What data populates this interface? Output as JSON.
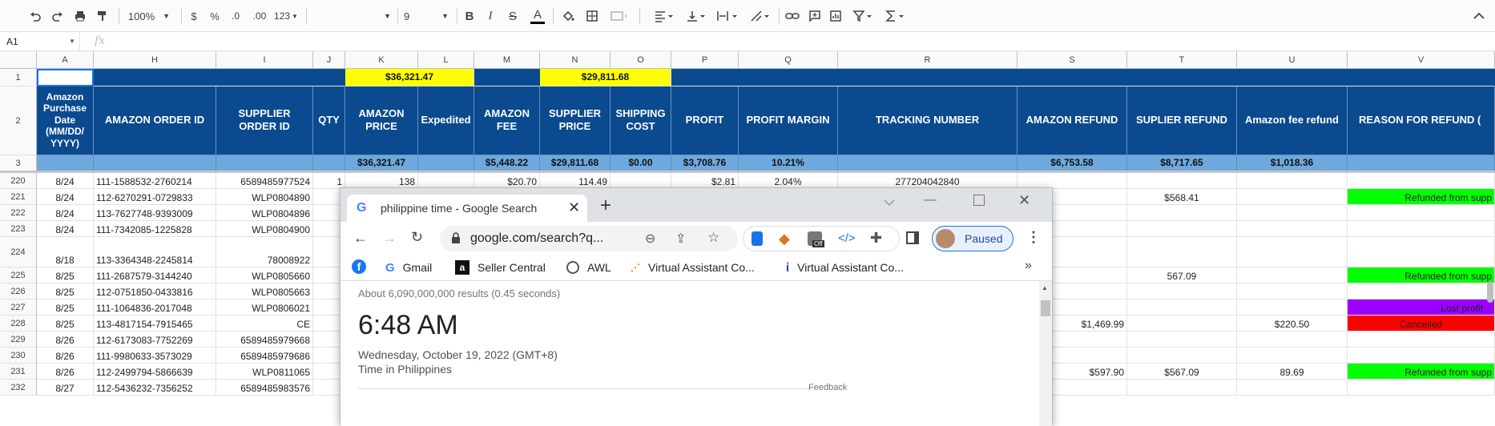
{
  "toolbar": {
    "zoom": "100%",
    "currency": "$",
    "percent": "%",
    "dec_less": ".0",
    "dec_more": ".00",
    "more_formats": "123",
    "font_size": "9",
    "bold": "B",
    "italic": "I",
    "strike": "S",
    "text_color": "A"
  },
  "formula_bar": {
    "name_box": "A1",
    "fx": "fx",
    "value": ""
  },
  "columns": [
    "A",
    "H",
    "I",
    "J",
    "K",
    "L",
    "M",
    "N",
    "O",
    "P",
    "Q",
    "R",
    "S",
    "T",
    "U",
    "V"
  ],
  "header_row1": {
    "k": "$36,321.47",
    "n": "$29,811.68"
  },
  "headers": {
    "a": "Amazon Purchase Date (MM/DD/ YYYY)",
    "h": "AMAZON ORDER ID",
    "i": "SUPPLIER ORDER ID",
    "j": "QTY",
    "k": "AMAZON PRICE",
    "l": "Expedited",
    "m": "AMAZON FEE",
    "n": "SUPPLIER PRICE",
    "o": "SHIPPING COST",
    "p": "PROFIT",
    "q": "PROFIT MARGIN",
    "r": "TRACKING NUMBER",
    "s": "AMAZON REFUND",
    "t": "SUPLIER REFUND",
    "u": "Amazon fee refund",
    "v": "REASON FOR REFUND ("
  },
  "totals": {
    "k": "$36,321.47",
    "m": "$5,448.22",
    "n": "$29,811.68",
    "o": "$0.00",
    "p": "$3,708.76",
    "q": "10.21%",
    "s": "$6,753.58",
    "t": "$8,717.65",
    "u": "$1,018.36"
  },
  "rows": [
    {
      "num": "220",
      "a": "8/24",
      "h": "111-1588532-2760214",
      "i": "6589485977524",
      "j": "1",
      "k": "138",
      "m": "$20.70",
      "n": "114.49",
      "p": "$2.81",
      "q": "2.04%",
      "r": "277204042840",
      "s": "",
      "t": "",
      "u": "",
      "v": ""
    },
    {
      "num": "221",
      "a": "8/24",
      "h": "112-6270291-0729833",
      "i": "WLP0804890",
      "j": "",
      "s": "",
      "t": "$568.41",
      "u": "",
      "v": "Refunded from supp"
    },
    {
      "num": "222",
      "a": "8/24",
      "h": "113-7627748-9393009",
      "i": "WLP0804896",
      "j": "",
      "s": "",
      "t": "",
      "u": "",
      "v": ""
    },
    {
      "num": "223",
      "a": "8/24",
      "h": "111-7342085-1225828",
      "i": "WLP0804900",
      "j": "",
      "s": "",
      "t": "",
      "u": "",
      "v": ""
    },
    {
      "num": "224",
      "a": "8/18",
      "h": "113-3364348-2245814",
      "i": "78008922",
      "j": "",
      "s": "",
      "t": "",
      "u": "",
      "v": ""
    },
    {
      "num": "225",
      "a": "8/25",
      "h": "111-2687579-3144240",
      "i": "WLP0805660",
      "j": "",
      "s": "",
      "t": "567.09",
      "u": "",
      "v": "Refunded from supp"
    },
    {
      "num": "226",
      "a": "8/25",
      "h": "112-0751850-0433816",
      "i": "WLP0805663",
      "j": "",
      "s": "",
      "t": "",
      "u": "",
      "v": ""
    },
    {
      "num": "227",
      "a": "8/25",
      "h": "111-1064836-2017048",
      "i": "WLP0806021",
      "j": "",
      "s": "",
      "t": "",
      "u": "",
      "v": "Lost profit"
    },
    {
      "num": "228",
      "a": "8/25",
      "h": "113-4817154-7915465",
      "i": "CE",
      "j": "",
      "s": "$1,469.99",
      "t": "",
      "u": "$220.50",
      "v": "Cancelled"
    },
    {
      "num": "229",
      "a": "8/26",
      "h": "112-6173083-7752269",
      "i": "6589485979668",
      "j": "",
      "s": "",
      "t": "",
      "u": "",
      "v": ""
    },
    {
      "num": "230",
      "a": "8/26",
      "h": "111-9980633-3573029",
      "i": "6589485979686",
      "j": "",
      "s": "",
      "t": "",
      "u": "",
      "v": ""
    },
    {
      "num": "231",
      "a": "8/26",
      "h": "112-2499794-5866639",
      "i": "WLP0811065",
      "j": "",
      "s": "$597.90",
      "t": "$567.09",
      "u": "89.69",
      "v": "Refunded from supp"
    },
    {
      "num": "232",
      "a": "8/27",
      "h": "112-5436232-7356252",
      "i": "6589485983576",
      "j": "",
      "s": "",
      "t": "",
      "u": "",
      "v": ""
    }
  ],
  "colors": {
    "header_blue": "#0b4a8f",
    "total_blue": "#6fa8dc",
    "yellow": "#ffff00",
    "green": "#00ff00",
    "purple": "#9900ff",
    "red": "#ff0000"
  },
  "browser": {
    "tab_title": "philippine time - Google Search",
    "url": "google.com/search?q...",
    "profile_status": "Paused",
    "bookmarks": [
      "Gmail",
      "Seller Central",
      "AWL",
      "Virtual Assistant Co...",
      "Virtual Assistant Co..."
    ],
    "results_count": "About 6,090,000,000 results (0.45 seconds)",
    "time": "6:48 AM",
    "date": "Wednesday, October 19, 2022 (GMT+8)",
    "location": "Time in Philippines",
    "feedback": "Feedback",
    "ext_badge": "Off"
  }
}
